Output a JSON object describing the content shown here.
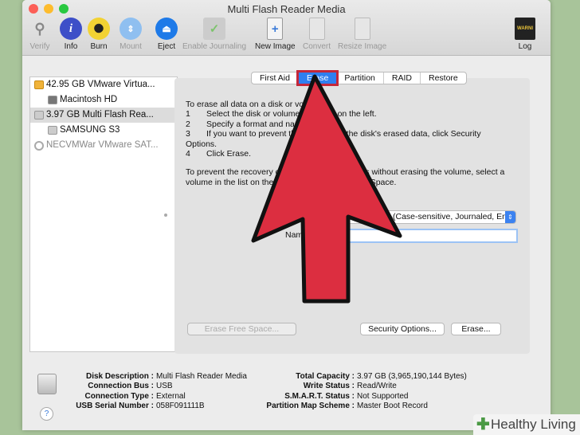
{
  "window": {
    "title": "Multi Flash Reader Media"
  },
  "toolbar": [
    {
      "label": "Verify"
    },
    {
      "label": "Info"
    },
    {
      "label": "Burn"
    },
    {
      "label": "Mount"
    },
    {
      "label": "Eject"
    },
    {
      "label": "Enable Journaling"
    },
    {
      "label": "New Image"
    },
    {
      "label": "Convert"
    },
    {
      "label": "Resize Image"
    },
    {
      "label": "Log"
    }
  ],
  "sidebar": {
    "items": [
      {
        "label": "42.95 GB VMware Virtua..."
      },
      {
        "label": "Macintosh HD"
      },
      {
        "label": "3.97 GB Multi Flash Rea..."
      },
      {
        "label": "SAMSUNG S3"
      },
      {
        "label": "NECVMWar VMware SAT..."
      }
    ]
  },
  "tabs": [
    {
      "label": "First Aid"
    },
    {
      "label": "Erase"
    },
    {
      "label": "Partition"
    },
    {
      "label": "RAID"
    },
    {
      "label": "Restore"
    }
  ],
  "erase": {
    "intro": "To erase all data on a disk or volume:",
    "steps": [
      {
        "n": "1",
        "t": "Select the disk or volume in the list on the left."
      },
      {
        "n": "2",
        "t": "Specify a format and name."
      },
      {
        "n": "3",
        "t": "If you want to prevent the recovery of the disk's erased data, click Security"
      }
    ],
    "step3_cont": "Options.",
    "step4": {
      "n": "4",
      "t": "Click Erase."
    },
    "free_space_note": "To prevent the recovery of previously deleted files without erasing the volume, select a volume in the list on the left, and click Erase Free Space.",
    "format_value": "(Case-sensitive, Journaled, En",
    "name_label": "Name:",
    "name_value": "",
    "erase_free_space": "Erase Free Space...",
    "security_options": "Security Options...",
    "erase_button": "Erase..."
  },
  "info": {
    "left": [
      {
        "k": "Disk Description :",
        "v": "Multi Flash Reader Media"
      },
      {
        "k": "Connection Bus :",
        "v": "USB"
      },
      {
        "k": "Connection Type :",
        "v": "External"
      },
      {
        "k": "USB Serial Number :",
        "v": "058F091111B"
      }
    ],
    "right": [
      {
        "k": "Total Capacity :",
        "v": "3.97 GB (3,965,190,144 Bytes)"
      },
      {
        "k": "Write Status :",
        "v": "Read/Write"
      },
      {
        "k": "S.M.A.R.T. Status :",
        "v": "Not Supported"
      },
      {
        "k": "Partition Map Scheme :",
        "v": "Master Boot Record"
      }
    ]
  },
  "help": "?",
  "watermark": "Healthy Living",
  "colors": {
    "arrow": "#dc2e40",
    "accent": "#2f7ff0",
    "highlight": "#c5283a"
  }
}
